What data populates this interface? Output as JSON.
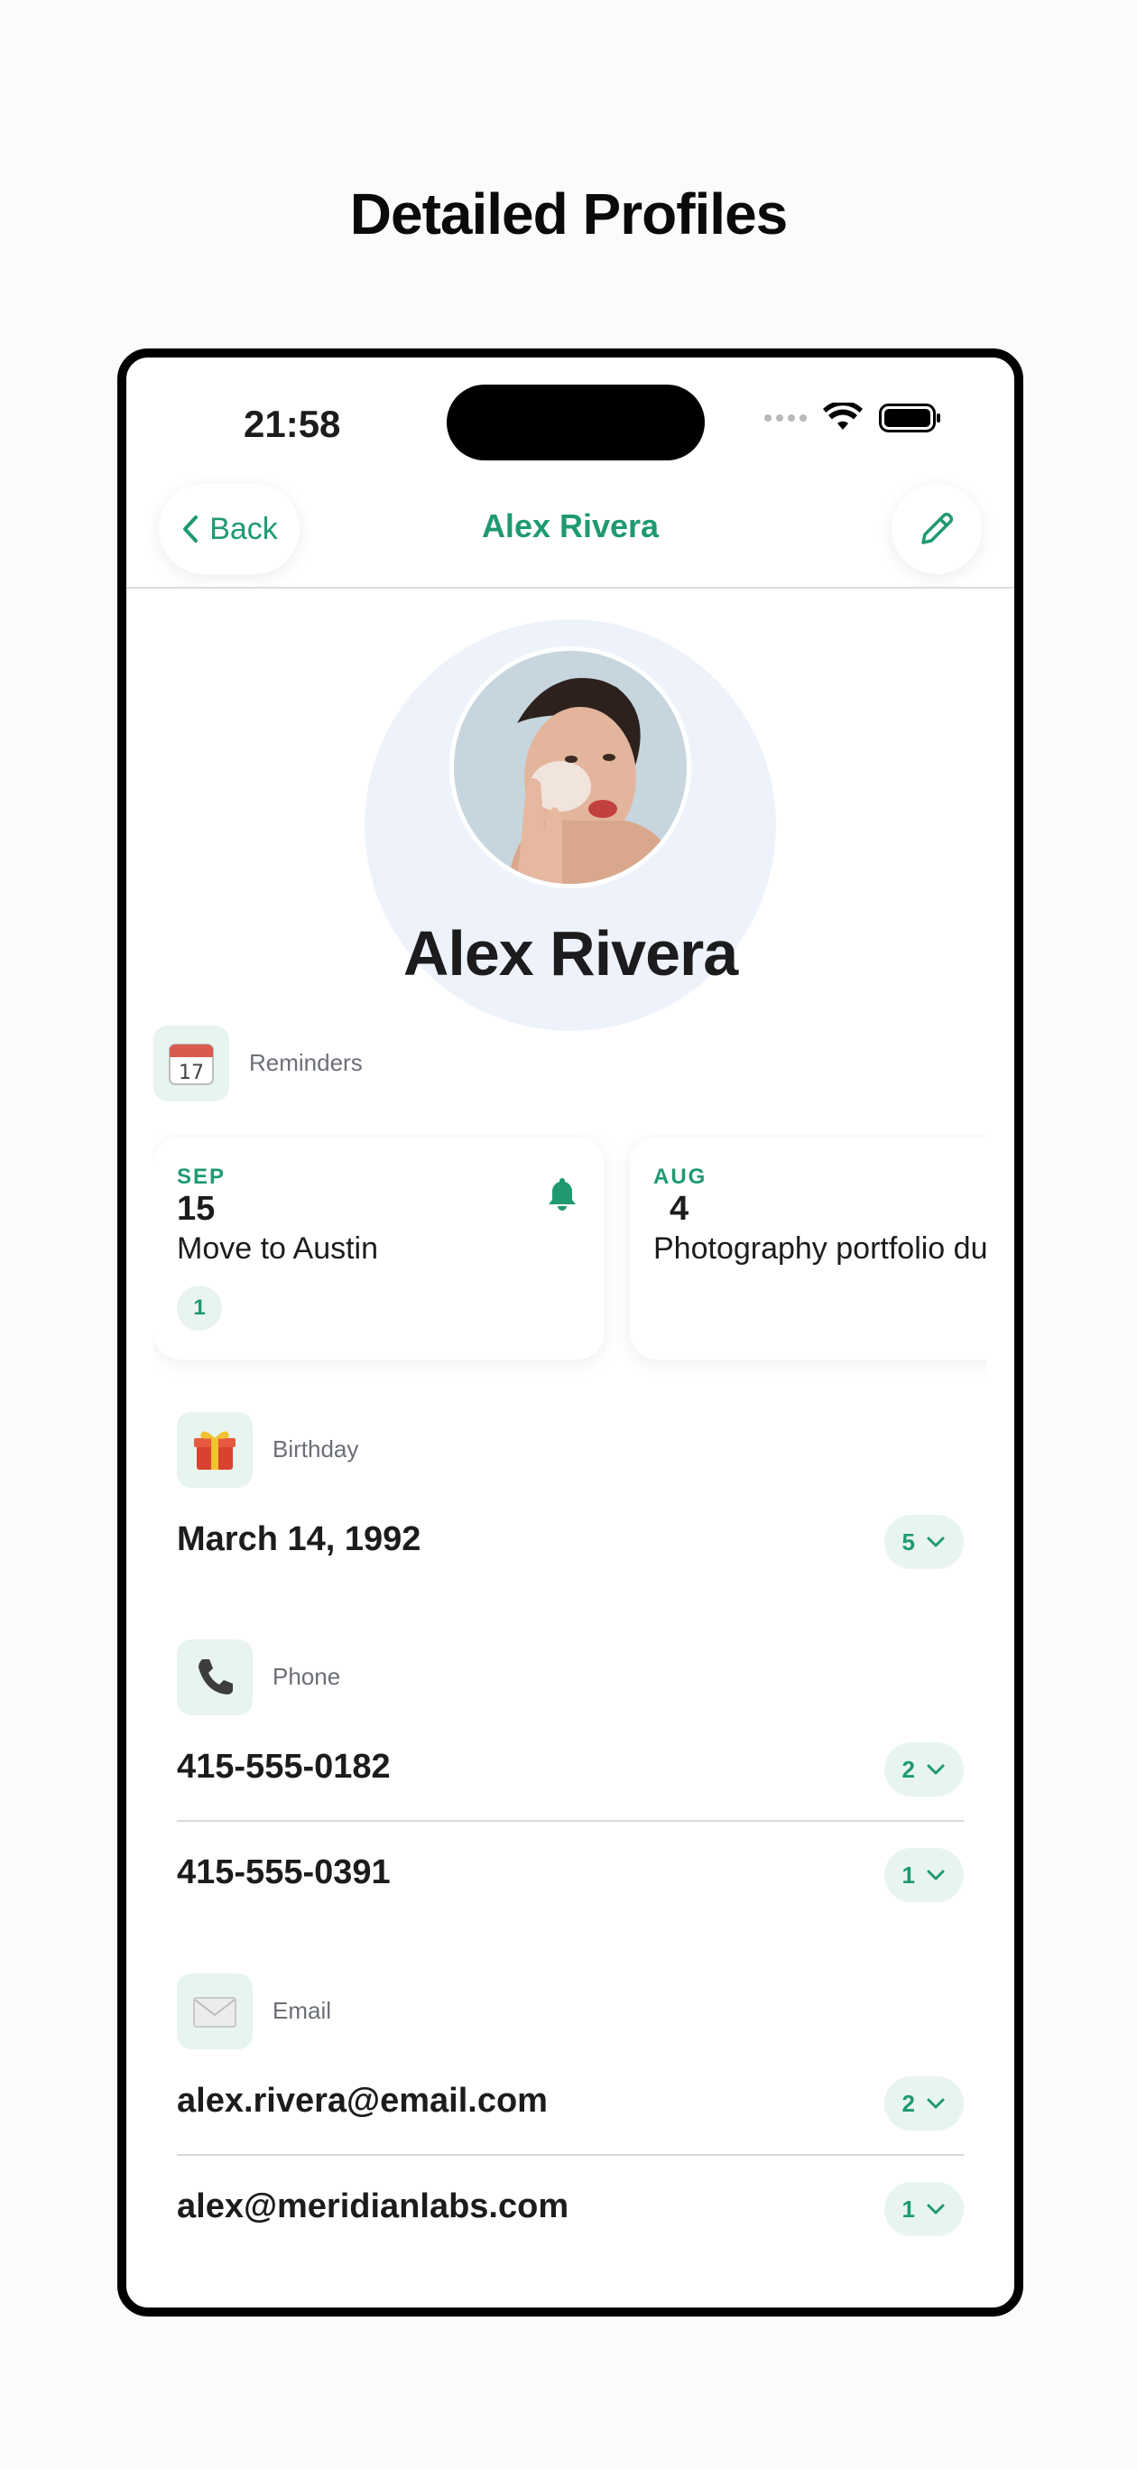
{
  "headline": "Detailed Profiles",
  "status": {
    "time": "21:58"
  },
  "nav": {
    "back_label": "Back",
    "title": "Alex Rivera"
  },
  "profile": {
    "name": "Alex Rivera"
  },
  "reminders": {
    "label": "Reminders",
    "icon_day": "17",
    "items": [
      {
        "month": "SEP",
        "day": "15",
        "title": "Move to Austin",
        "count": "1"
      },
      {
        "month": "AUG",
        "day": "4",
        "title": "Photography portfolio due"
      }
    ]
  },
  "birthday": {
    "label": "Birthday",
    "value": "March 14, 1992",
    "count": "5"
  },
  "phone": {
    "label": "Phone",
    "items": [
      {
        "value": "415-555-0182",
        "count": "2"
      },
      {
        "value": "415-555-0391",
        "count": "1"
      }
    ]
  },
  "email": {
    "label": "Email",
    "items": [
      {
        "value": "alex.rivera@email.com",
        "count": "2"
      },
      {
        "value": "alex@meridianlabs.com",
        "count": "1"
      }
    ]
  },
  "colors": {
    "accent": "#1f9a6f",
    "chip_bg": "#e8f4ee",
    "halo": "#eef3fb"
  }
}
